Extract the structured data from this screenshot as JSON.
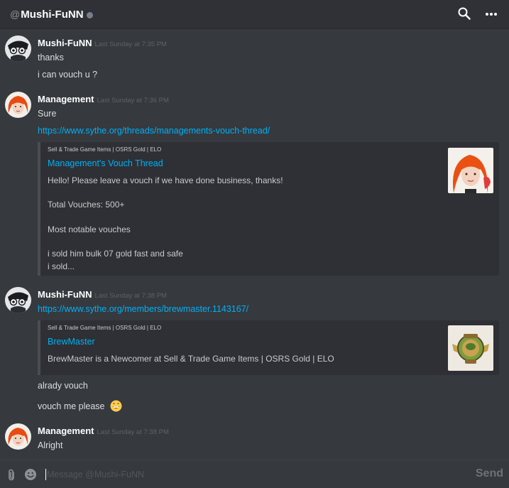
{
  "header": {
    "at_symbol": "@",
    "title": "Mushi-FuNN"
  },
  "messages": [
    {
      "author": "Mushi-FuNN",
      "timestamp": "Last Sunday at 7:35 PM",
      "lines": [
        "thanks",
        "i can vouch u ?"
      ]
    },
    {
      "author": "Management",
      "timestamp": "Last Sunday at 7:36 PM",
      "lines": [
        "Sure"
      ],
      "link": "https://www.sythe.org/threads/managements-vouch-thread/",
      "embed": {
        "provider": "Sell & Trade Game Items | OSRS Gold | ELO",
        "title": "Management's Vouch Thread",
        "description": [
          "Hello! Please leave a vouch if we have done business, thanks!",
          "Total Vouches: 500+",
          "Most notable vouches",
          "i sold him bulk 07 gold fast and safe",
          "i sold..."
        ]
      }
    },
    {
      "author": "Mushi-FuNN",
      "timestamp": "Last Sunday at 7:38 PM",
      "link": "https://www.sythe.org/members/brewmaster.1143167/",
      "embed": {
        "provider": "Sell & Trade Game Items | OSRS Gold | ELO",
        "title": "BrewMaster",
        "description": [
          "BrewMaster is a Newcomer at Sell & Trade Game Items | OSRS Gold | ELO"
        ]
      },
      "lines_after": [
        "alrady vouch",
        "vouch me please"
      ]
    },
    {
      "author": "Management",
      "timestamp": "Last Sunday at 7:38 PM",
      "lines": [
        "Alright"
      ]
    }
  ],
  "composer": {
    "placeholder": "Message @Mushi-FuNN",
    "send_label": "Send"
  },
  "colors": {
    "background": "#36393e",
    "header": "#2f3136",
    "link": "#00b0f4",
    "embed_bg": "#2e3035"
  }
}
